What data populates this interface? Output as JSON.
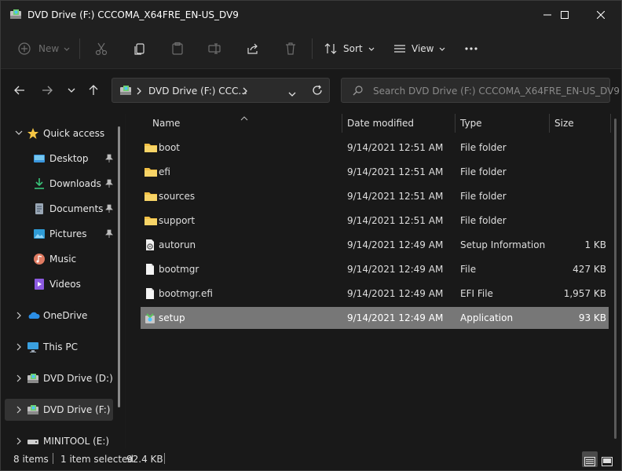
{
  "window": {
    "title": "DVD Drive (F:) CCCOMA_X64FRE_EN-US_DV9",
    "controls": [
      "minimize",
      "maximize",
      "close"
    ]
  },
  "toolbar": {
    "new_label": "New",
    "sort_label": "Sort",
    "view_label": "View",
    "icons": [
      "cut-icon",
      "copy-icon",
      "paste-icon",
      "rename-icon",
      "share-icon",
      "delete-icon",
      "more-icon"
    ]
  },
  "address": {
    "breadcrumb": "DVD Drive (F:) CCC...",
    "search_placeholder": "Search DVD Drive (F:) CCCOMA_X64FRE_EN-US_DV9"
  },
  "sidebar": {
    "items": [
      {
        "label": "Quick access",
        "icon": "star-icon",
        "expanded": true
      },
      {
        "label": "Desktop",
        "icon": "desktop-icon",
        "pinned": true
      },
      {
        "label": "Downloads",
        "icon": "download-icon",
        "pinned": true
      },
      {
        "label": "Documents",
        "icon": "document-icon",
        "pinned": true
      },
      {
        "label": "Pictures",
        "icon": "pictures-icon",
        "pinned": true
      },
      {
        "label": "Music",
        "icon": "music-icon"
      },
      {
        "label": "Videos",
        "icon": "video-icon"
      },
      {
        "label": "OneDrive",
        "icon": "cloud-icon"
      },
      {
        "label": "This PC",
        "icon": "pc-icon"
      },
      {
        "label": "DVD Drive (D:) CC",
        "icon": "dvd-icon"
      },
      {
        "label": "DVD Drive (F:) CC",
        "icon": "dvd-icon",
        "selected": true
      },
      {
        "label": "MINITOOL (E:)",
        "icon": "drive-icon"
      }
    ]
  },
  "columns": {
    "name": "Name",
    "date": "Date modified",
    "type": "Type",
    "size": "Size"
  },
  "files": [
    {
      "name": "boot",
      "date": "9/14/2021 12:51 AM",
      "type": "File folder",
      "size": "",
      "icon": "folder-icon"
    },
    {
      "name": "efi",
      "date": "9/14/2021 12:51 AM",
      "type": "File folder",
      "size": "",
      "icon": "folder-icon"
    },
    {
      "name": "sources",
      "date": "9/14/2021 12:51 AM",
      "type": "File folder",
      "size": "",
      "icon": "folder-icon"
    },
    {
      "name": "support",
      "date": "9/14/2021 12:51 AM",
      "type": "File folder",
      "size": "",
      "icon": "folder-icon"
    },
    {
      "name": "autorun",
      "date": "9/14/2021 12:49 AM",
      "type": "Setup Information",
      "size": "1 KB",
      "icon": "setup-info-icon"
    },
    {
      "name": "bootmgr",
      "date": "9/14/2021 12:49 AM",
      "type": "File",
      "size": "427 KB",
      "icon": "file-icon"
    },
    {
      "name": "bootmgr.efi",
      "date": "9/14/2021 12:49 AM",
      "type": "EFI File",
      "size": "1,957 KB",
      "icon": "file-icon"
    },
    {
      "name": "setup",
      "date": "9/14/2021 12:49 AM",
      "type": "Application",
      "size": "93 KB",
      "icon": "app-icon",
      "selected": true
    }
  ],
  "status": {
    "item_count": "8 items",
    "selection": "1 item selected",
    "selection_size": "92.4 KB"
  },
  "colors": {
    "background": "#191919",
    "chrome": "#202020",
    "selection": "#777777",
    "folder": "#F2C045",
    "accent": "#4CC2FF"
  }
}
